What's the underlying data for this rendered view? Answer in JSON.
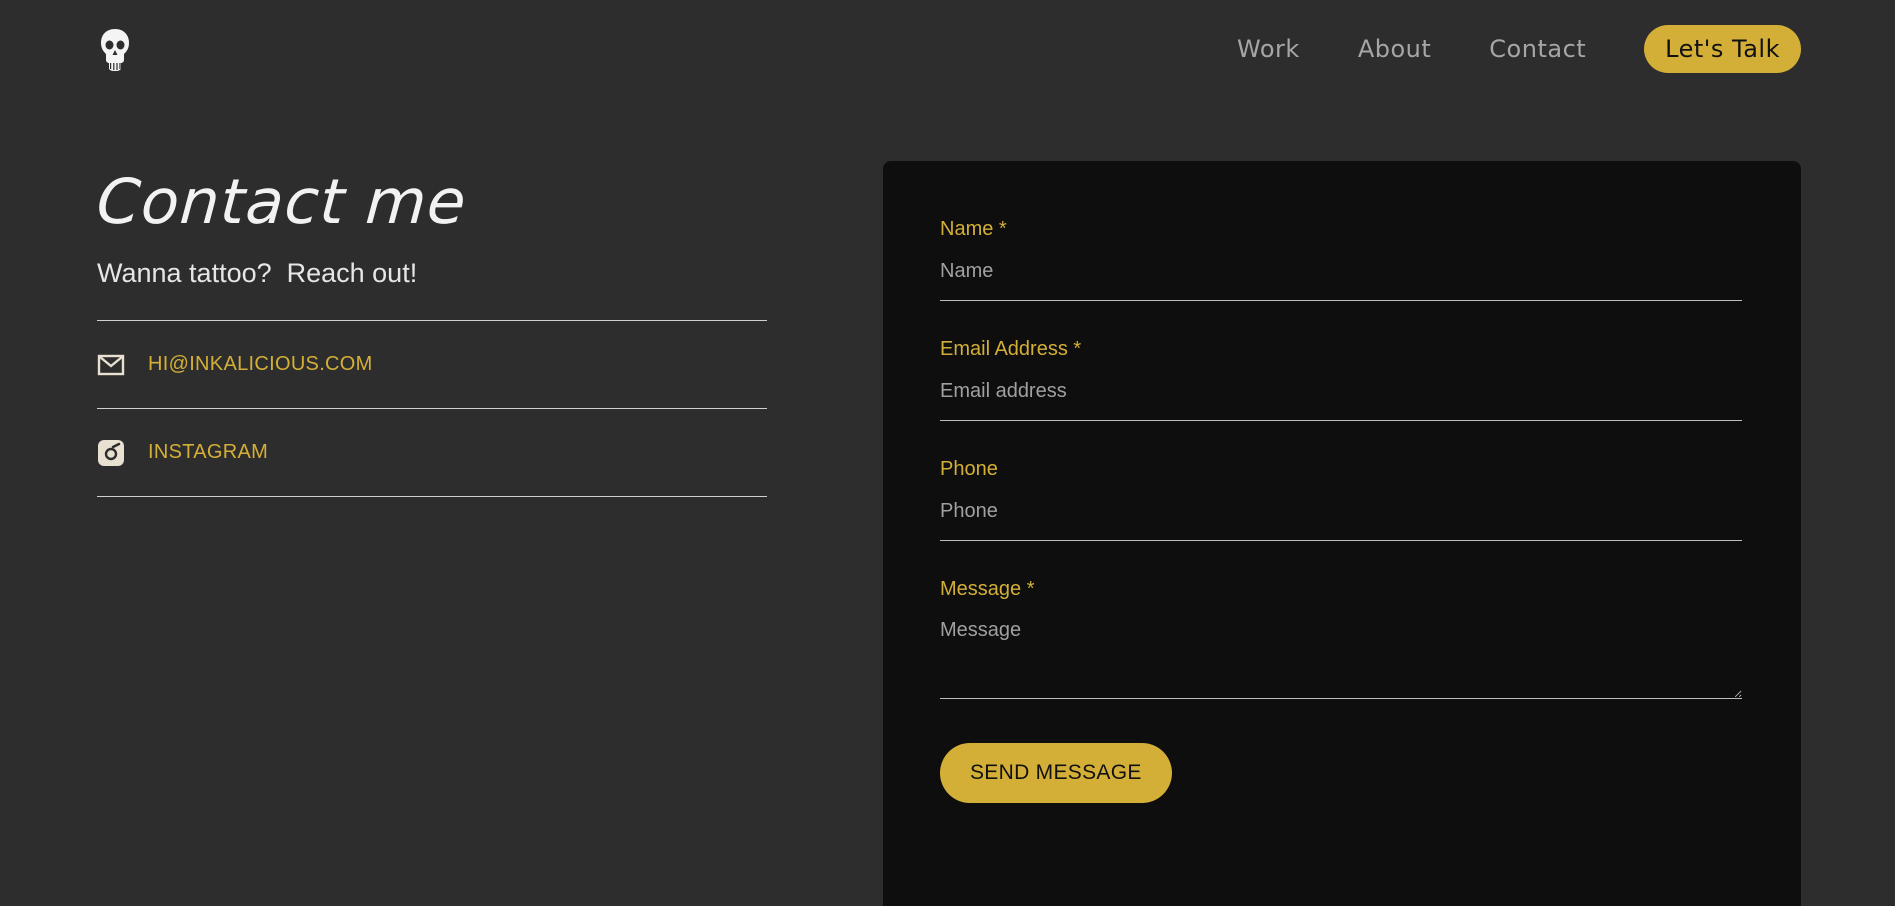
{
  "nav": {
    "links": [
      "Work",
      "About",
      "Contact"
    ],
    "cta_label": "Let's Talk"
  },
  "contact": {
    "title": "Contact me",
    "subtitle": "Wanna tattoo?  Reach out!",
    "email_label": "HI@INKALICIOUS.COM",
    "instagram_label": "INSTAGRAM"
  },
  "form": {
    "name_label": "Name *",
    "name_placeholder": "Name",
    "email_label": "Email Address *",
    "email_placeholder": "Email address",
    "phone_label": "Phone",
    "phone_placeholder": "Phone",
    "message_label": "Message *",
    "message_placeholder": "Message",
    "submit_label": "SEND MESSAGE"
  },
  "colors": {
    "background": "#2d2d2d",
    "panel": "#0e0e0e",
    "accent": "#d4af37"
  },
  "icons": {
    "logo": "skull-icon",
    "email": "mail-icon",
    "instagram": "instagram-icon"
  }
}
